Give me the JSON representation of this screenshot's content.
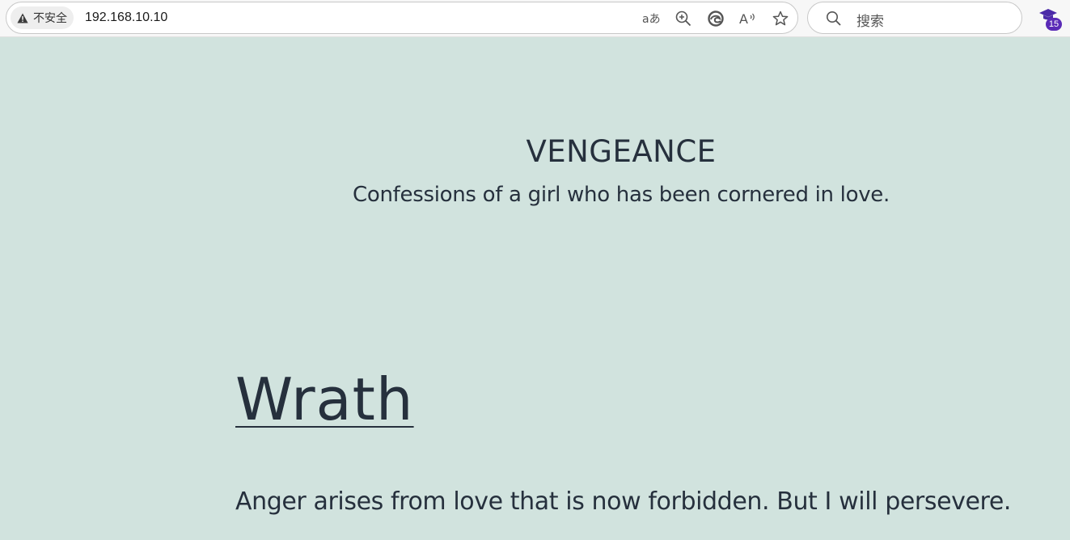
{
  "browser": {
    "security_label": "不安全",
    "url": "192.168.10.10",
    "search_placeholder": "搜索",
    "extension_badge": "15",
    "toolbar_icons": [
      "read-aloud-translate-icon",
      "zoom-in-icon",
      "edge-copilot-icon",
      "read-aloud-icon",
      "favorite-star-icon"
    ]
  },
  "site": {
    "title": "VENGEANCE",
    "subtitle": "Confessions of a girl who has been cornered in love."
  },
  "post": {
    "title": "Wrath",
    "excerpt": "Anger arises from love that is now forbidden. But I will persevere."
  },
  "colors": {
    "page_background": "#d1e3de",
    "text": "#26303d",
    "extension_accent": "#5a2bb7"
  }
}
